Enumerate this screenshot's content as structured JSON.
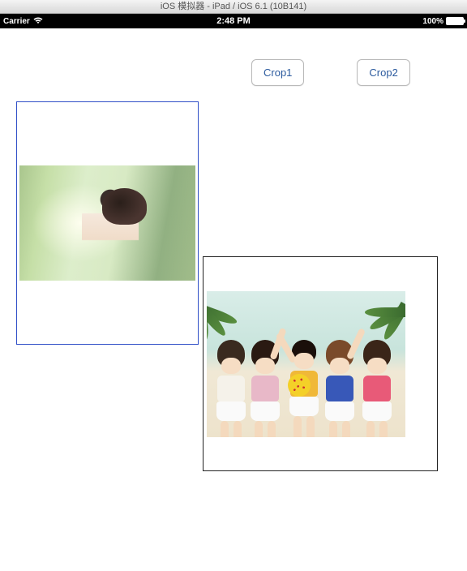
{
  "window": {
    "title": "iOS 模拟器 - iPad / iOS 6.1 (10B141)"
  },
  "statusbar": {
    "carrier": "Carrier",
    "time": "2:48 PM",
    "battery": "100%"
  },
  "buttons": {
    "crop1": "Crop1",
    "crop2": "Crop2"
  }
}
